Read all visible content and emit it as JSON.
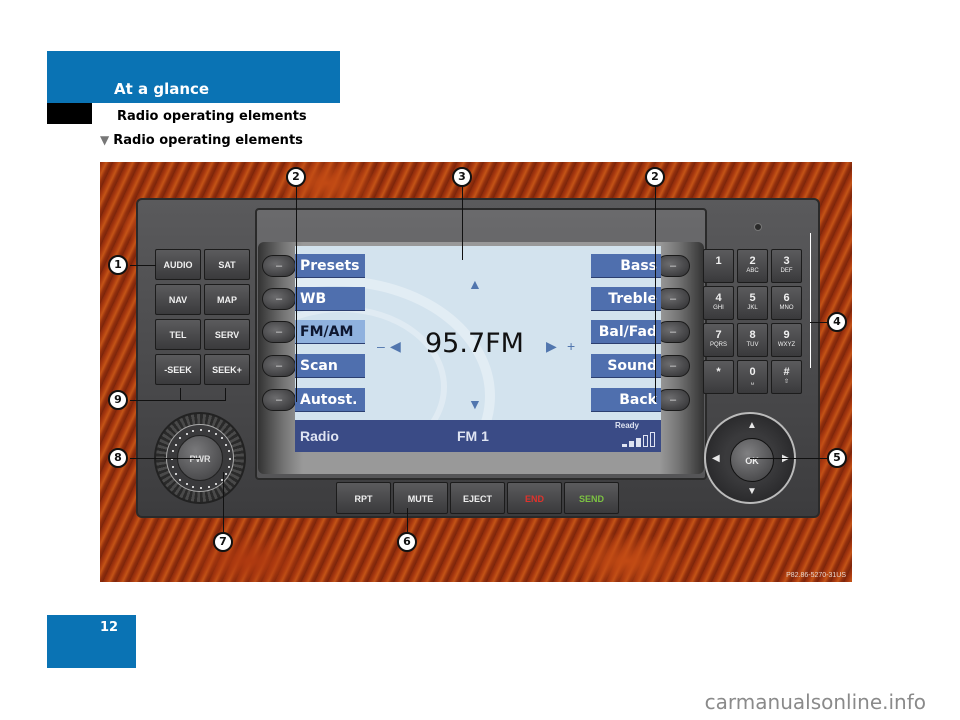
{
  "header": {
    "section": "At a glance",
    "subsection": "Radio operating elements",
    "heading": "Radio operating elements",
    "heading_icon": "triangle-down-icon"
  },
  "figure": {
    "code": "P82.86-5270-31US",
    "left_buttons": [
      "AUDIO",
      "SAT",
      "NAV",
      "MAP",
      "TEL",
      "SERV",
      "-SEEK",
      "SEEK+"
    ],
    "keypad": [
      {
        "digit": "1",
        "letters": ""
      },
      {
        "digit": "2",
        "letters": "ABC"
      },
      {
        "digit": "3",
        "letters": "DEF"
      },
      {
        "digit": "4",
        "letters": "GHI"
      },
      {
        "digit": "5",
        "letters": "JKL"
      },
      {
        "digit": "6",
        "letters": "MNO"
      },
      {
        "digit": "7",
        "letters": "PQRS"
      },
      {
        "digit": "8",
        "letters": "TUV"
      },
      {
        "digit": "9",
        "letters": "WXYZ"
      },
      {
        "digit": "*",
        "letters": ""
      },
      {
        "digit": "0",
        "letters": "␣"
      },
      {
        "digit": "#",
        "letters": "⇧"
      }
    ],
    "bottom_buttons": [
      {
        "label": "RPT",
        "color": "#f0f0f0"
      },
      {
        "label": "MUTE",
        "color": "#f0f0f0"
      },
      {
        "label": "EJECT",
        "color": "#f0f0f0"
      },
      {
        "label": "END",
        "color": "#e0322b"
      },
      {
        "label": "SEND",
        "color": "#7cc242"
      }
    ],
    "knob_label": "PWR",
    "ok_label": "OK",
    "side_key_symbol": "–",
    "screen": {
      "left_softkeys": [
        "Presets",
        "WB",
        "FM/AM",
        "Scan",
        "Autost."
      ],
      "active_softkey": "FM/AM",
      "right_softkeys": [
        "Bass",
        "Treble",
        "Bal/Fad",
        "Sound",
        "Back"
      ],
      "frequency": "95.7FM",
      "minus": "–",
      "plus": "+",
      "status_left": "Radio",
      "status_mid": "FM 1",
      "status_ready": "Ready",
      "signal_bars_filled": 3,
      "signal_bars_total": 5
    },
    "callouts": [
      "1",
      "2",
      "3",
      "2",
      "4",
      "5",
      "6",
      "7",
      "8",
      "9"
    ]
  },
  "page_number": "12",
  "site": "carmanualsonline.info"
}
